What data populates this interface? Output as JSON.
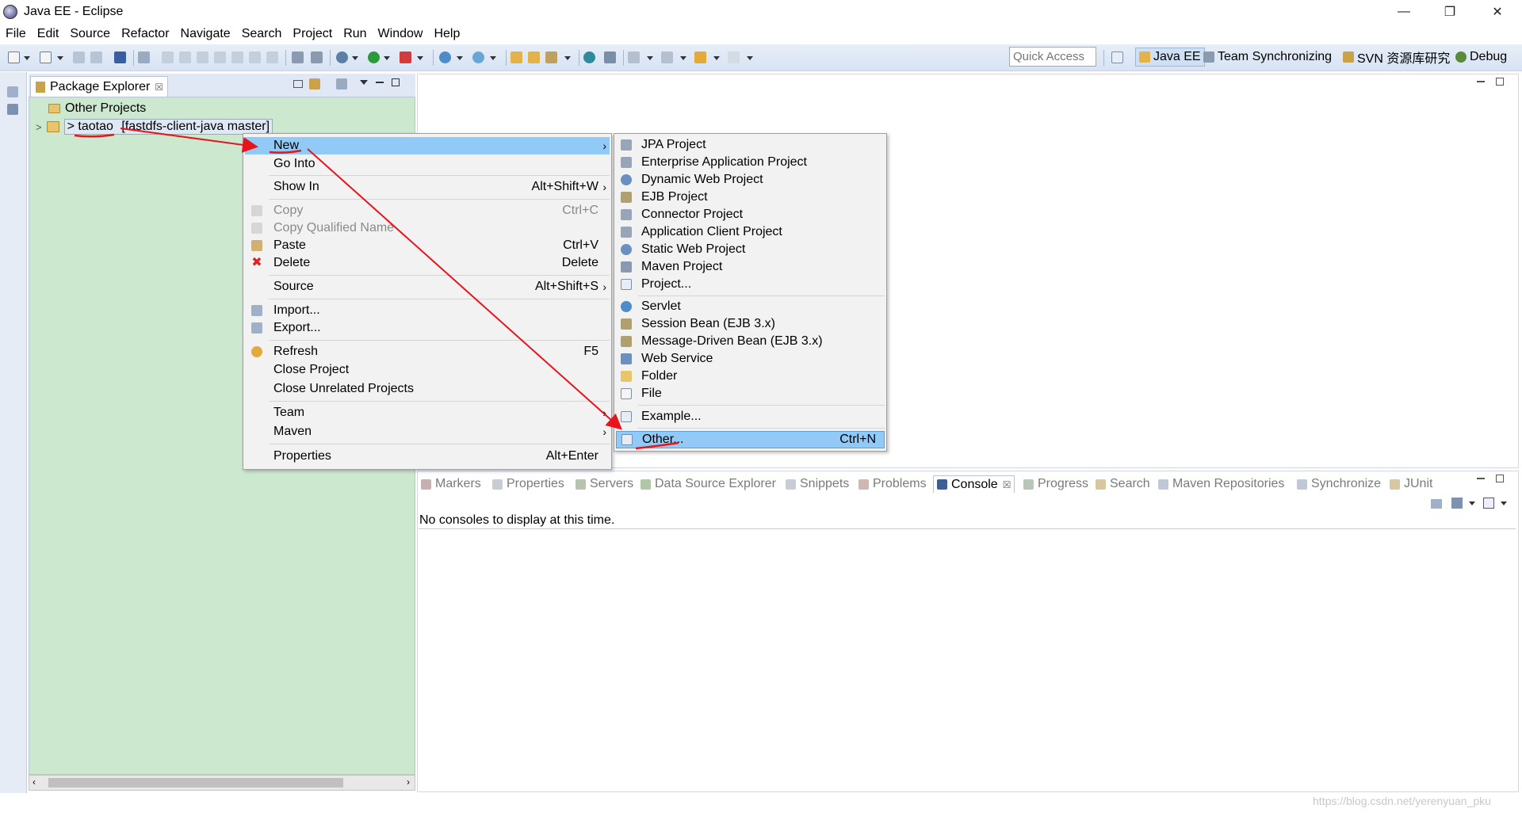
{
  "window": {
    "title": "Java EE - Eclipse",
    "minimize": "—",
    "maximize": "❐",
    "close": "✕"
  },
  "menubar": [
    "File",
    "Edit",
    "Source",
    "Refactor",
    "Navigate",
    "Search",
    "Project",
    "Run",
    "Window",
    "Help"
  ],
  "toolbar": {
    "quick_access_placeholder": "Quick Access"
  },
  "perspectives": [
    {
      "label": "Java EE",
      "active": true
    },
    {
      "label": "Team Synchronizing",
      "active": false
    },
    {
      "label": "SVN 资源库研究",
      "active": false
    },
    {
      "label": "Debug",
      "active": false
    }
  ],
  "package_explorer": {
    "title": "Package Explorer",
    "close_glyph": "☒",
    "items": [
      {
        "label": "Other Projects"
      },
      {
        "expander": ">",
        "prefix": ">",
        "name": "taotao",
        "repo": "[fastdfs-client-java master]"
      }
    ]
  },
  "context_menu": {
    "items": [
      {
        "label": "New",
        "shortcut": "",
        "submenu": true,
        "highlighted": true,
        "disabled": false
      },
      {
        "label": "Go Into",
        "shortcut": "",
        "submenu": false,
        "disabled": false
      },
      {
        "label": "Show In",
        "shortcut": "Alt+Shift+W",
        "submenu": true,
        "disabled": false
      },
      {
        "label": "Copy",
        "shortcut": "Ctrl+C",
        "submenu": false,
        "disabled": true
      },
      {
        "label": "Copy Qualified Name",
        "shortcut": "",
        "submenu": false,
        "disabled": true
      },
      {
        "label": "Paste",
        "shortcut": "Ctrl+V",
        "submenu": false,
        "disabled": false
      },
      {
        "label": "Delete",
        "shortcut": "Delete",
        "submenu": false,
        "disabled": false
      },
      {
        "label": "Source",
        "shortcut": "Alt+Shift+S",
        "submenu": true,
        "disabled": false
      },
      {
        "label": "Import...",
        "shortcut": "",
        "submenu": false,
        "disabled": false
      },
      {
        "label": "Export...",
        "shortcut": "",
        "submenu": false,
        "disabled": false
      },
      {
        "label": "Refresh",
        "shortcut": "F5",
        "submenu": false,
        "disabled": false
      },
      {
        "label": "Close Project",
        "shortcut": "",
        "submenu": false,
        "disabled": false
      },
      {
        "label": "Close Unrelated Projects",
        "shortcut": "",
        "submenu": false,
        "disabled": false
      },
      {
        "label": "Team",
        "shortcut": "",
        "submenu": true,
        "disabled": false
      },
      {
        "label": "Maven",
        "shortcut": "",
        "submenu": true,
        "disabled": false
      },
      {
        "label": "Properties",
        "shortcut": "Alt+Enter",
        "submenu": false,
        "disabled": false
      }
    ],
    "arrow_glyph": "›"
  },
  "new_submenu": {
    "items": [
      {
        "label": "JPA Project",
        "shortcut": ""
      },
      {
        "label": "Enterprise Application Project",
        "shortcut": ""
      },
      {
        "label": "Dynamic Web Project",
        "shortcut": ""
      },
      {
        "label": "EJB Project",
        "shortcut": ""
      },
      {
        "label": "Connector Project",
        "shortcut": ""
      },
      {
        "label": "Application Client Project",
        "shortcut": ""
      },
      {
        "label": "Static Web Project",
        "shortcut": ""
      },
      {
        "label": "Maven Project",
        "shortcut": ""
      },
      {
        "label": "Project...",
        "shortcut": ""
      },
      {
        "label": "Servlet",
        "shortcut": ""
      },
      {
        "label": "Session Bean (EJB 3.x)",
        "shortcut": ""
      },
      {
        "label": "Message-Driven Bean (EJB 3.x)",
        "shortcut": ""
      },
      {
        "label": "Web Service",
        "shortcut": ""
      },
      {
        "label": "Folder",
        "shortcut": ""
      },
      {
        "label": "File",
        "shortcut": ""
      },
      {
        "label": "Example...",
        "shortcut": ""
      },
      {
        "label": "Other...",
        "shortcut": "Ctrl+N",
        "highlighted": true
      }
    ]
  },
  "bottom_tabs": [
    {
      "label": "Markers",
      "active": false
    },
    {
      "label": "Properties",
      "active": false
    },
    {
      "label": "Servers",
      "active": false
    },
    {
      "label": "Data Source Explorer",
      "active": false
    },
    {
      "label": "Snippets",
      "active": false
    },
    {
      "label": "Problems",
      "active": false
    },
    {
      "label": "Console",
      "active": true
    },
    {
      "label": "Progress",
      "active": false
    },
    {
      "label": "Search",
      "active": false
    },
    {
      "label": "Maven Repositories",
      "active": false
    },
    {
      "label": "Synchronize",
      "active": false
    },
    {
      "label": "JUnit",
      "active": false
    }
  ],
  "console": {
    "message": "No consoles to display at this time.",
    "close_glyph": "☒"
  },
  "watermark": "https://blog.csdn.net/yerenyuan_pku",
  "colors": {
    "explorer_bg": "#cce8cf",
    "menu_highlight": "#91c9f7",
    "annotation": "#e8141b"
  }
}
